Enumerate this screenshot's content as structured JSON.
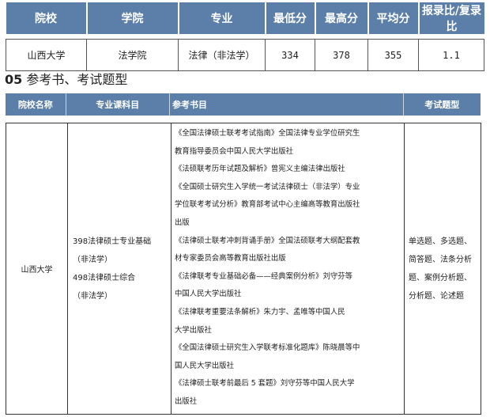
{
  "score_table": {
    "headers": [
      "院校",
      "学院",
      "专业",
      "最低分",
      "最高分",
      "平均分",
      "报录比/复录比"
    ],
    "row": {
      "school": "山西大学",
      "college": "法学院",
      "major": "法律（非法学）",
      "min": "334",
      "max": "378",
      "avg": "355",
      "ratio": "1.1"
    }
  },
  "section": {
    "number": "05",
    "title": "参考书、考试题型"
  },
  "ref_table": {
    "headers": {
      "school": "院校名称",
      "subject": "专业课科目",
      "books": "参考书目",
      "types": "考试题型"
    },
    "row": {
      "school": "山西大学",
      "subjects": [
        "398法律硕士专业基础",
        "（非法学）",
        "498法律硕士综合",
        "（非法学）"
      ],
      "books": [
        "《全国法律硕士联考考试指南》全国法律专业学位研究生",
        "教育指导委员会中国人民大学出版社",
        "《法硕联考历年试题及解析》曾宪义主编法律出版社",
        "《全国硕士研究生入学统一考试法律硕士（非法学）专业",
        "学位联考考试分析》教育部考试中心主编高等教育出版社",
        "出版",
        "《法律硕士联考冲刺背诵手册》全国法硕联考大纲配套教",
        "材专家委员会高等教育出版社出版",
        "《法律联考专业基础必备——经典案例分析》刘守芬等",
        "中国人民大学出版社",
        "《法律联考重要法条解析》朱力宇、孟唯等中国人民",
        "大学出版社",
        "《全国法律硕士研究生入学联考标准化题库》陈晓晨等中",
        "国人民大学出版社",
        "《法律硕士联考前最后 5 套题》刘守芬等中国人民大学",
        "出版社"
      ],
      "types": [
        "单选题、多选题、",
        "简答题、法条分析",
        "题、案例分析题、",
        "分析题、论述题"
      ]
    }
  }
}
